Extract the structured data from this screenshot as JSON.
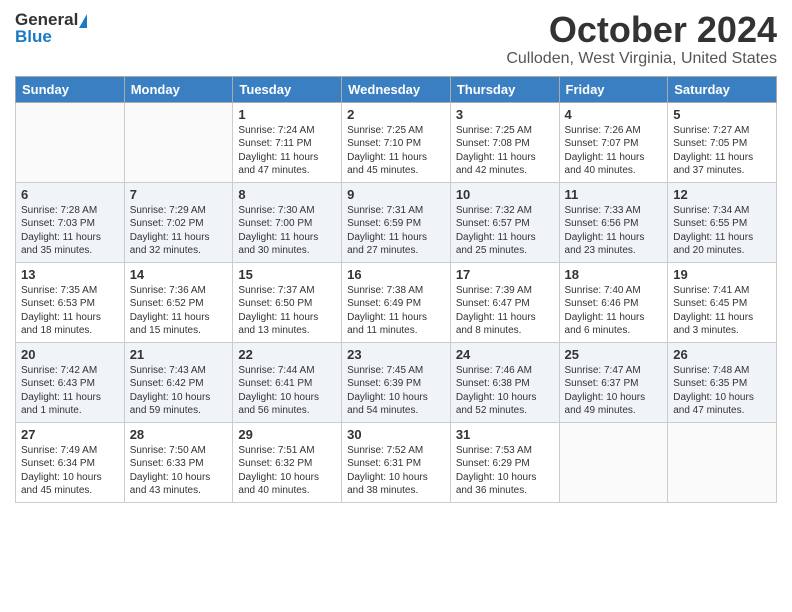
{
  "logo": {
    "general": "General",
    "blue": "Blue"
  },
  "title": "October 2024",
  "subtitle": "Culloden, West Virginia, United States",
  "days_of_week": [
    "Sunday",
    "Monday",
    "Tuesday",
    "Wednesday",
    "Thursday",
    "Friday",
    "Saturday"
  ],
  "weeks": [
    [
      {
        "day": null,
        "info": null
      },
      {
        "day": null,
        "info": null
      },
      {
        "day": "1",
        "info": "Sunrise: 7:24 AM\nSunset: 7:11 PM\nDaylight: 11 hours\nand 47 minutes."
      },
      {
        "day": "2",
        "info": "Sunrise: 7:25 AM\nSunset: 7:10 PM\nDaylight: 11 hours\nand 45 minutes."
      },
      {
        "day": "3",
        "info": "Sunrise: 7:25 AM\nSunset: 7:08 PM\nDaylight: 11 hours\nand 42 minutes."
      },
      {
        "day": "4",
        "info": "Sunrise: 7:26 AM\nSunset: 7:07 PM\nDaylight: 11 hours\nand 40 minutes."
      },
      {
        "day": "5",
        "info": "Sunrise: 7:27 AM\nSunset: 7:05 PM\nDaylight: 11 hours\nand 37 minutes."
      }
    ],
    [
      {
        "day": "6",
        "info": "Sunrise: 7:28 AM\nSunset: 7:03 PM\nDaylight: 11 hours\nand 35 minutes."
      },
      {
        "day": "7",
        "info": "Sunrise: 7:29 AM\nSunset: 7:02 PM\nDaylight: 11 hours\nand 32 minutes."
      },
      {
        "day": "8",
        "info": "Sunrise: 7:30 AM\nSunset: 7:00 PM\nDaylight: 11 hours\nand 30 minutes."
      },
      {
        "day": "9",
        "info": "Sunrise: 7:31 AM\nSunset: 6:59 PM\nDaylight: 11 hours\nand 27 minutes."
      },
      {
        "day": "10",
        "info": "Sunrise: 7:32 AM\nSunset: 6:57 PM\nDaylight: 11 hours\nand 25 minutes."
      },
      {
        "day": "11",
        "info": "Sunrise: 7:33 AM\nSunset: 6:56 PM\nDaylight: 11 hours\nand 23 minutes."
      },
      {
        "day": "12",
        "info": "Sunrise: 7:34 AM\nSunset: 6:55 PM\nDaylight: 11 hours\nand 20 minutes."
      }
    ],
    [
      {
        "day": "13",
        "info": "Sunrise: 7:35 AM\nSunset: 6:53 PM\nDaylight: 11 hours\nand 18 minutes."
      },
      {
        "day": "14",
        "info": "Sunrise: 7:36 AM\nSunset: 6:52 PM\nDaylight: 11 hours\nand 15 minutes."
      },
      {
        "day": "15",
        "info": "Sunrise: 7:37 AM\nSunset: 6:50 PM\nDaylight: 11 hours\nand 13 minutes."
      },
      {
        "day": "16",
        "info": "Sunrise: 7:38 AM\nSunset: 6:49 PM\nDaylight: 11 hours\nand 11 minutes."
      },
      {
        "day": "17",
        "info": "Sunrise: 7:39 AM\nSunset: 6:47 PM\nDaylight: 11 hours\nand 8 minutes."
      },
      {
        "day": "18",
        "info": "Sunrise: 7:40 AM\nSunset: 6:46 PM\nDaylight: 11 hours\nand 6 minutes."
      },
      {
        "day": "19",
        "info": "Sunrise: 7:41 AM\nSunset: 6:45 PM\nDaylight: 11 hours\nand 3 minutes."
      }
    ],
    [
      {
        "day": "20",
        "info": "Sunrise: 7:42 AM\nSunset: 6:43 PM\nDaylight: 11 hours\nand 1 minute."
      },
      {
        "day": "21",
        "info": "Sunrise: 7:43 AM\nSunset: 6:42 PM\nDaylight: 10 hours\nand 59 minutes."
      },
      {
        "day": "22",
        "info": "Sunrise: 7:44 AM\nSunset: 6:41 PM\nDaylight: 10 hours\nand 56 minutes."
      },
      {
        "day": "23",
        "info": "Sunrise: 7:45 AM\nSunset: 6:39 PM\nDaylight: 10 hours\nand 54 minutes."
      },
      {
        "day": "24",
        "info": "Sunrise: 7:46 AM\nSunset: 6:38 PM\nDaylight: 10 hours\nand 52 minutes."
      },
      {
        "day": "25",
        "info": "Sunrise: 7:47 AM\nSunset: 6:37 PM\nDaylight: 10 hours\nand 49 minutes."
      },
      {
        "day": "26",
        "info": "Sunrise: 7:48 AM\nSunset: 6:35 PM\nDaylight: 10 hours\nand 47 minutes."
      }
    ],
    [
      {
        "day": "27",
        "info": "Sunrise: 7:49 AM\nSunset: 6:34 PM\nDaylight: 10 hours\nand 45 minutes."
      },
      {
        "day": "28",
        "info": "Sunrise: 7:50 AM\nSunset: 6:33 PM\nDaylight: 10 hours\nand 43 minutes."
      },
      {
        "day": "29",
        "info": "Sunrise: 7:51 AM\nSunset: 6:32 PM\nDaylight: 10 hours\nand 40 minutes."
      },
      {
        "day": "30",
        "info": "Sunrise: 7:52 AM\nSunset: 6:31 PM\nDaylight: 10 hours\nand 38 minutes."
      },
      {
        "day": "31",
        "info": "Sunrise: 7:53 AM\nSunset: 6:29 PM\nDaylight: 10 hours\nand 36 minutes."
      },
      {
        "day": null,
        "info": null
      },
      {
        "day": null,
        "info": null
      }
    ]
  ]
}
